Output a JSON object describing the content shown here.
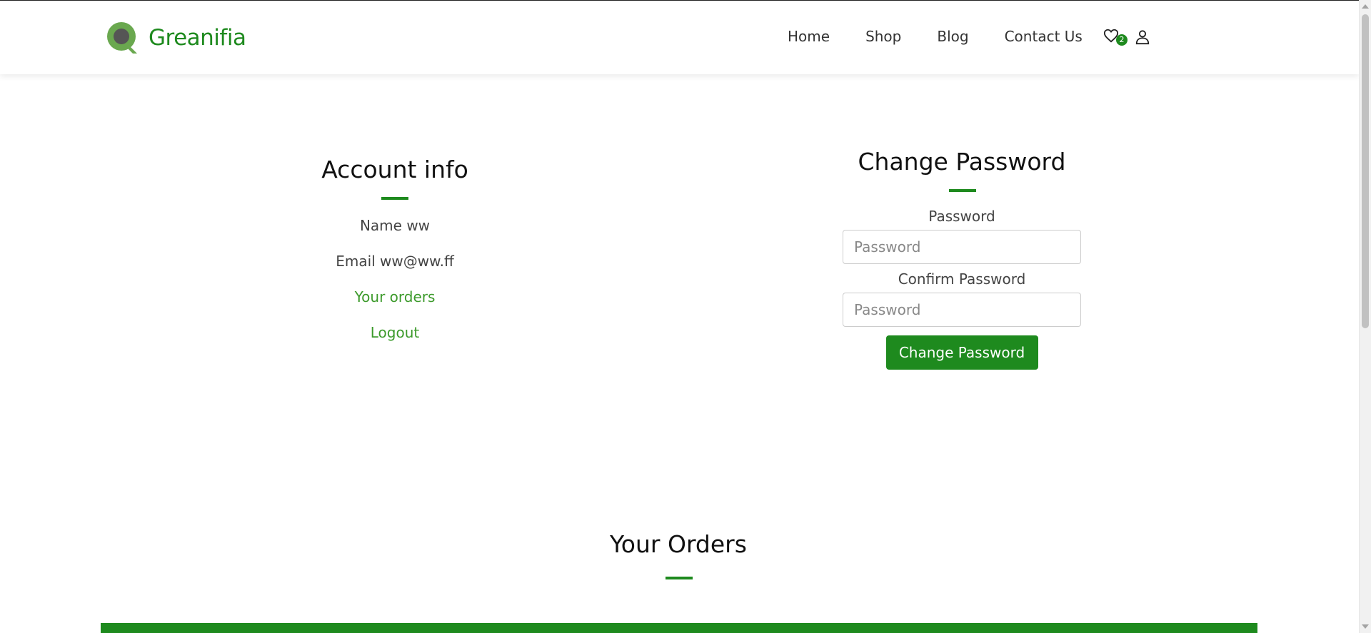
{
  "brand": {
    "name": "Greanifia",
    "color": "#1e8a1e"
  },
  "nav": {
    "items": [
      "Home",
      "Shop",
      "Blog",
      "Contact Us"
    ],
    "wishlist_count": "2"
  },
  "account": {
    "title": "Account info",
    "name_line": "Name ww",
    "email_line": "Email ww@ww.ff",
    "orders_link": "Your orders",
    "logout_link": "Logout"
  },
  "change_password": {
    "title": "Change Password",
    "password_label": "Password",
    "password_placeholder": "Password",
    "confirm_label": "Confirm Password",
    "confirm_placeholder": "Password",
    "submit_label": "Change Password"
  },
  "orders": {
    "title": "Your Orders"
  }
}
